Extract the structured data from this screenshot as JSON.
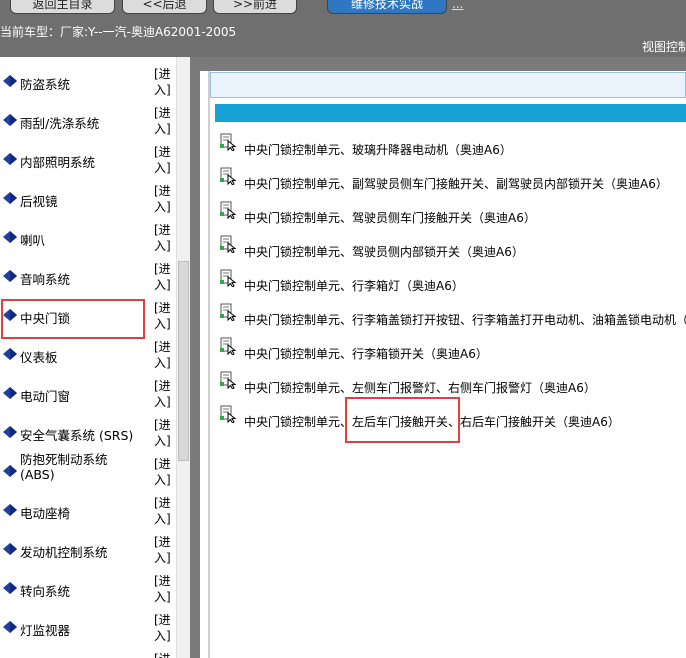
{
  "toolbar": {
    "home_label": "返回主目录",
    "back_label": "<<后退",
    "forward_label": ">>前进",
    "repair_tech_label": "维修技术实战",
    "more_link": "..."
  },
  "vehicle_info": {
    "text": "当前车型：厂家:Y--一汽-奥迪A62001-2005"
  },
  "view_control": {
    "label": "视图控制"
  },
  "sidebar": {
    "enter_label": "[进入]",
    "items": [
      {
        "label": "防盗系统"
      },
      {
        "label": "雨刮/洗涤系统"
      },
      {
        "label": "内部照明系统"
      },
      {
        "label": "后视镜"
      },
      {
        "label": "喇叭"
      },
      {
        "label": "音响系统"
      },
      {
        "label": "中央门锁"
      },
      {
        "label": "仪表板"
      },
      {
        "label": "电动门窗"
      },
      {
        "label": "安全气囊系统 (SRS)"
      },
      {
        "label": "防抱死制动系统 (ABS)"
      },
      {
        "label": "电动座椅"
      },
      {
        "label": "发动机控制系统"
      },
      {
        "label": "转向系统"
      },
      {
        "label": "灯监视器"
      }
    ]
  },
  "content": {
    "rows": [
      {
        "text": "中央门锁控制单元、玻璃升降器电动机（奥迪A6）"
      },
      {
        "text": "中央门锁控制单元、副驾驶员侧车门接触开关、副驾驶员内部锁开关（奥迪A6）"
      },
      {
        "text": "中央门锁控制单元、驾驶员侧车门接触开关（奥迪A6）"
      },
      {
        "text": "中央门锁控制单元、驾驶员侧内部锁开关（奥迪A6）"
      },
      {
        "text": "中央门锁控制单元、行李箱灯（奥迪A6）"
      },
      {
        "text": "中央门锁控制单元、行李箱盖锁打开按钮、行李箱盖打开电动机、油箱盖锁电动机（奥"
      },
      {
        "text": "中央门锁控制单元、行李箱锁开关（奥迪A6）"
      },
      {
        "text": "中央门锁控制单元、左侧车门报警灯、右侧车门报警灯（奥迪A6）"
      },
      {
        "text": "中央门锁控制单元、左后车门接触开关、右后车门接触开关（奥迪A6）"
      }
    ]
  },
  "colors": {
    "toolbar_bg": "#6f6f6f",
    "accent_bar": "#19a2d6",
    "highlight": "#e04040",
    "diamond": "#1f3fa8"
  }
}
